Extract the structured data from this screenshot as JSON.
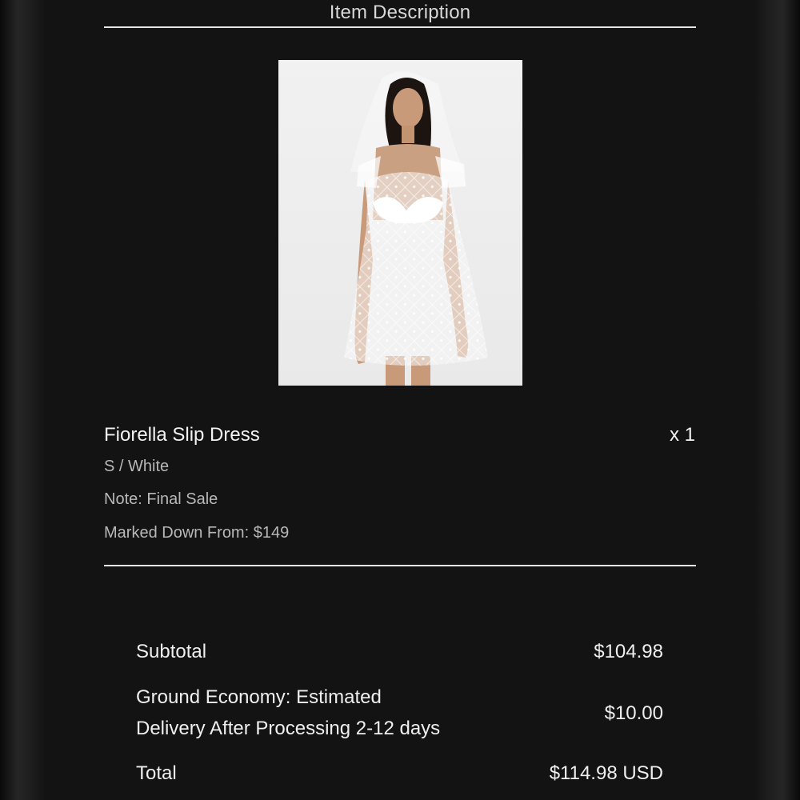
{
  "header": {
    "title": "Item Description"
  },
  "item": {
    "image_icon": "product-photo-white-lace-slip-dress",
    "name": "Fiorella Slip Dress",
    "quantity": "x 1",
    "variant": "S / White",
    "note": "Note: Final Sale",
    "marked_down": "Marked Down From: $149"
  },
  "summary": {
    "subtotal_label": "Subtotal",
    "subtotal_value": "$104.98",
    "shipping_label_line1": "Ground Economy: Estimated",
    "shipping_label_line2": "Delivery After Processing 2-12 days",
    "shipping_value": "$10.00",
    "total_label": "Total",
    "total_value": "$114.98 USD"
  },
  "colors": {
    "background": "#131313",
    "text_primary": "#f2f2f2",
    "text_secondary": "#b8b8b8",
    "divider": "#e6e6e6"
  }
}
